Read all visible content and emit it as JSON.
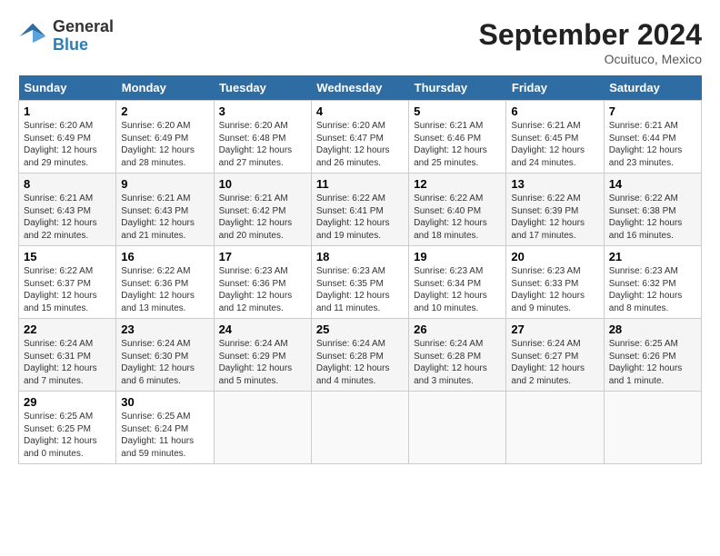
{
  "logo": {
    "line1": "General",
    "line2": "Blue"
  },
  "title": "September 2024",
  "location": "Ocuituco, Mexico",
  "weekdays": [
    "Sunday",
    "Monday",
    "Tuesday",
    "Wednesday",
    "Thursday",
    "Friday",
    "Saturday"
  ],
  "weeks": [
    [
      {
        "day": "1",
        "sunrise": "6:20 AM",
        "sunset": "6:49 PM",
        "daylight": "12 hours and 29 minutes."
      },
      {
        "day": "2",
        "sunrise": "6:20 AM",
        "sunset": "6:49 PM",
        "daylight": "12 hours and 28 minutes."
      },
      {
        "day": "3",
        "sunrise": "6:20 AM",
        "sunset": "6:48 PM",
        "daylight": "12 hours and 27 minutes."
      },
      {
        "day": "4",
        "sunrise": "6:20 AM",
        "sunset": "6:47 PM",
        "daylight": "12 hours and 26 minutes."
      },
      {
        "day": "5",
        "sunrise": "6:21 AM",
        "sunset": "6:46 PM",
        "daylight": "12 hours and 25 minutes."
      },
      {
        "day": "6",
        "sunrise": "6:21 AM",
        "sunset": "6:45 PM",
        "daylight": "12 hours and 24 minutes."
      },
      {
        "day": "7",
        "sunrise": "6:21 AM",
        "sunset": "6:44 PM",
        "daylight": "12 hours and 23 minutes."
      }
    ],
    [
      {
        "day": "8",
        "sunrise": "6:21 AM",
        "sunset": "6:43 PM",
        "daylight": "12 hours and 22 minutes."
      },
      {
        "day": "9",
        "sunrise": "6:21 AM",
        "sunset": "6:43 PM",
        "daylight": "12 hours and 21 minutes."
      },
      {
        "day": "10",
        "sunrise": "6:21 AM",
        "sunset": "6:42 PM",
        "daylight": "12 hours and 20 minutes."
      },
      {
        "day": "11",
        "sunrise": "6:22 AM",
        "sunset": "6:41 PM",
        "daylight": "12 hours and 19 minutes."
      },
      {
        "day": "12",
        "sunrise": "6:22 AM",
        "sunset": "6:40 PM",
        "daylight": "12 hours and 18 minutes."
      },
      {
        "day": "13",
        "sunrise": "6:22 AM",
        "sunset": "6:39 PM",
        "daylight": "12 hours and 17 minutes."
      },
      {
        "day": "14",
        "sunrise": "6:22 AM",
        "sunset": "6:38 PM",
        "daylight": "12 hours and 16 minutes."
      }
    ],
    [
      {
        "day": "15",
        "sunrise": "6:22 AM",
        "sunset": "6:37 PM",
        "daylight": "12 hours and 15 minutes."
      },
      {
        "day": "16",
        "sunrise": "6:22 AM",
        "sunset": "6:36 PM",
        "daylight": "12 hours and 13 minutes."
      },
      {
        "day": "17",
        "sunrise": "6:23 AM",
        "sunset": "6:36 PM",
        "daylight": "12 hours and 12 minutes."
      },
      {
        "day": "18",
        "sunrise": "6:23 AM",
        "sunset": "6:35 PM",
        "daylight": "12 hours and 11 minutes."
      },
      {
        "day": "19",
        "sunrise": "6:23 AM",
        "sunset": "6:34 PM",
        "daylight": "12 hours and 10 minutes."
      },
      {
        "day": "20",
        "sunrise": "6:23 AM",
        "sunset": "6:33 PM",
        "daylight": "12 hours and 9 minutes."
      },
      {
        "day": "21",
        "sunrise": "6:23 AM",
        "sunset": "6:32 PM",
        "daylight": "12 hours and 8 minutes."
      }
    ],
    [
      {
        "day": "22",
        "sunrise": "6:24 AM",
        "sunset": "6:31 PM",
        "daylight": "12 hours and 7 minutes."
      },
      {
        "day": "23",
        "sunrise": "6:24 AM",
        "sunset": "6:30 PM",
        "daylight": "12 hours and 6 minutes."
      },
      {
        "day": "24",
        "sunrise": "6:24 AM",
        "sunset": "6:29 PM",
        "daylight": "12 hours and 5 minutes."
      },
      {
        "day": "25",
        "sunrise": "6:24 AM",
        "sunset": "6:28 PM",
        "daylight": "12 hours and 4 minutes."
      },
      {
        "day": "26",
        "sunrise": "6:24 AM",
        "sunset": "6:28 PM",
        "daylight": "12 hours and 3 minutes."
      },
      {
        "day": "27",
        "sunrise": "6:24 AM",
        "sunset": "6:27 PM",
        "daylight": "12 hours and 2 minutes."
      },
      {
        "day": "28",
        "sunrise": "6:25 AM",
        "sunset": "6:26 PM",
        "daylight": "12 hours and 1 minute."
      }
    ],
    [
      {
        "day": "29",
        "sunrise": "6:25 AM",
        "sunset": "6:25 PM",
        "daylight": "12 hours and 0 minutes."
      },
      {
        "day": "30",
        "sunrise": "6:25 AM",
        "sunset": "6:24 PM",
        "daylight": "11 hours and 59 minutes."
      },
      null,
      null,
      null,
      null,
      null
    ]
  ]
}
